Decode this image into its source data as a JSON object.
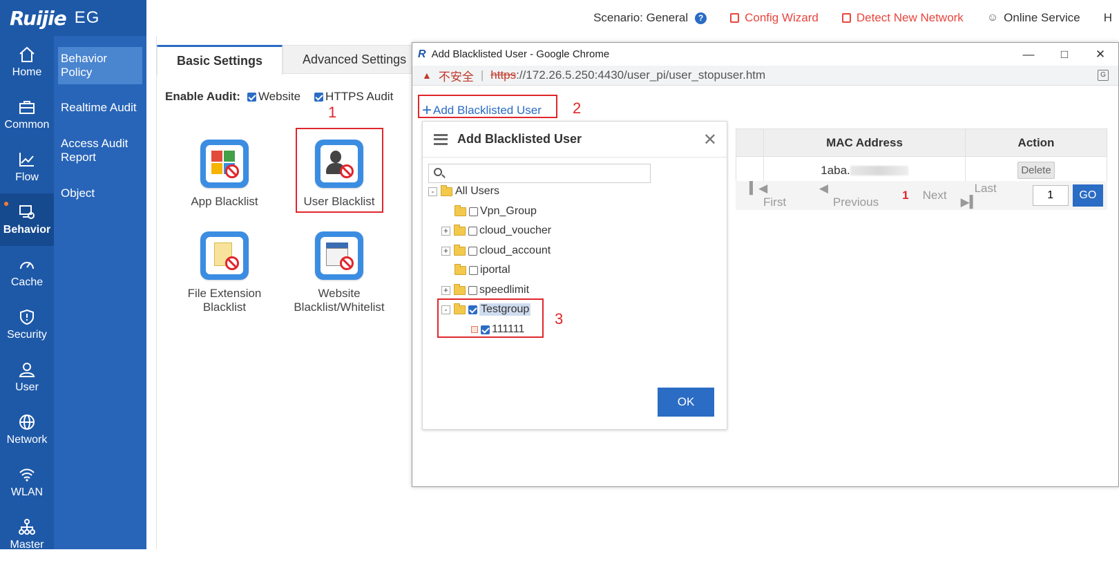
{
  "brand": {
    "logo": "Ruijie",
    "product": "EG"
  },
  "topbar": {
    "scenario_label": "Scenario:",
    "scenario_value": "General",
    "config_wizard": "Config Wizard",
    "detect_network": "Detect New Network",
    "online_service": "Online Service",
    "overflow": "H"
  },
  "leftnav": [
    {
      "label": "Home",
      "icon": "home-icon"
    },
    {
      "label": "Common",
      "icon": "briefcase-icon"
    },
    {
      "label": "Flow",
      "icon": "chart-line-icon"
    },
    {
      "label": "Behavior",
      "icon": "behavior-icon",
      "active": true
    },
    {
      "label": "Cache",
      "icon": "gauge-icon"
    },
    {
      "label": "Security",
      "icon": "shield-icon"
    },
    {
      "label": "User",
      "icon": "user-icon"
    },
    {
      "label": "Network",
      "icon": "globe-icon"
    },
    {
      "label": "WLAN",
      "icon": "wifi-icon"
    },
    {
      "label": "Master",
      "icon": "hierarchy-icon"
    }
  ],
  "subnav": [
    "Behavior Policy",
    "Realtime Audit",
    "Access Audit Report",
    "Object"
  ],
  "tabs": [
    "Basic Settings",
    "Advanced Settings"
  ],
  "enable_audit": {
    "label": "Enable Audit:",
    "website": "Website",
    "https": "HTTPS Audit"
  },
  "tiles": [
    "App Blacklist",
    "User Blacklist",
    "File Extension Blacklist",
    "Website Blacklist/Whitelist"
  ],
  "annotations": [
    "1",
    "2",
    "3"
  ],
  "popup": {
    "title": "Add Blacklisted User - Google Chrome",
    "unsafe": "不安全",
    "https": "https",
    "url_rest": "://172.26.5.250:4430/user_pi/user_stopuser.htm",
    "add_link": "Add Blacklisted User",
    "table": {
      "headers": [
        "MAC Address",
        "Action"
      ],
      "mac_prefix": "1aba.",
      "delete": "Delete"
    },
    "pager": {
      "first": "First",
      "previous": "Previous",
      "current": "1",
      "next": "Next",
      "last": "Last",
      "input": "1",
      "go": "GO"
    }
  },
  "dialog": {
    "title": "Add Blacklisted User",
    "tree": {
      "root": "All Users",
      "groups": [
        "Vpn_Group",
        "cloud_voucher",
        "cloud_account",
        "iportal",
        "speedlimit",
        "Testgroup"
      ],
      "child": "111111"
    },
    "ok": "OK"
  },
  "colors": {
    "brand_blue": "#1e59a8",
    "accent_red": "#e0262b",
    "link_blue": "#2b6cc4"
  }
}
